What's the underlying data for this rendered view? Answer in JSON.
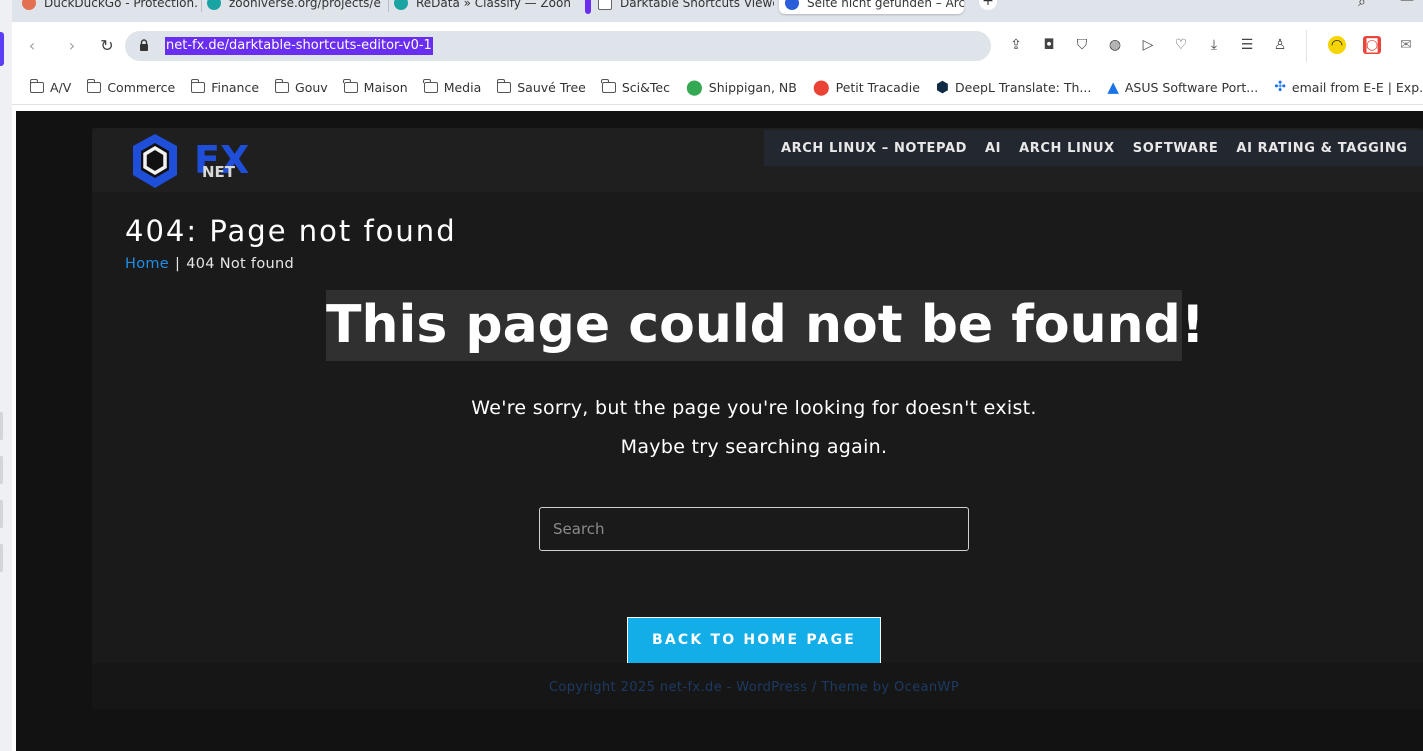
{
  "browser": {
    "tabs": [
      {
        "title": "DuckDuckGo - Protection.",
        "favicon": "duckduckgo-icon",
        "color": "#e37151"
      },
      {
        "title": "zooniverse.org/projects/e",
        "favicon": "zooniverse-icon",
        "color": "#1aa3a3"
      },
      {
        "title": "ReData » Classify — Zooni",
        "favicon": "zooniverse-icon",
        "color": "#1aa3a3"
      },
      {
        "title": "Darktable Shortcuts Viewe",
        "favicon": "image-icon",
        "color": "#666666"
      },
      {
        "title": "Seite nicht gefunden – Arc",
        "favicon": "netfx-icon",
        "color": "#2b5fd9"
      }
    ],
    "new_tab": "+",
    "url": "net-fx.de/darktable-shortcuts-editor-v0-1",
    "bookmarks": [
      {
        "label": "A/V",
        "icon": "folder-icon"
      },
      {
        "label": "Commerce",
        "icon": "folder-icon"
      },
      {
        "label": "Finance",
        "icon": "folder-icon"
      },
      {
        "label": "Gouv",
        "icon": "folder-icon"
      },
      {
        "label": "Maison",
        "icon": "folder-icon"
      },
      {
        "label": "Media",
        "icon": "folder-icon"
      },
      {
        "label": "Sauvé Tree",
        "icon": "folder-icon"
      },
      {
        "label": "Sci&Tec",
        "icon": "folder-icon"
      },
      {
        "label": "Shippigan, NB",
        "icon": "map-pin-icon"
      },
      {
        "label": "Petit Tracadie",
        "icon": "map-pin-icon"
      },
      {
        "label": "DeepL Translate: Th...",
        "icon": "deepl-icon"
      },
      {
        "label": "ASUS Software Port...",
        "icon": "asus-icon"
      },
      {
        "label": "email from E-E | Exp...",
        "icon": "experts-exchange-icon"
      }
    ]
  },
  "site": {
    "logo": {
      "letters": "FX",
      "sub": "NET"
    },
    "nav": [
      "ARCH LINUX – NOTEPAD",
      "AI",
      "ARCH LINUX",
      "SOFTWARE",
      "AI RATING & TAGGING"
    ],
    "page_title": "404: Page not found",
    "breadcrumb": {
      "home": "Home",
      "separator": "|",
      "current": "404 Not found"
    },
    "error_heading": "This page could not be found!",
    "error_line1": "We're sorry, but the page you're looking for doesn't exist.",
    "error_line2": "Maybe try searching again.",
    "search_placeholder": "Search",
    "back_button": "BACK TO HOME PAGE",
    "footer": {
      "prefix": "Copyright 2025 ",
      "brand": "net-fx.de",
      "sep": " - WordPress / ",
      "by": "Theme by OceanWP"
    }
  },
  "colors": {
    "accent": "#13aee8",
    "link": "#1e8fe8",
    "url_highlight": "#6a2ef0",
    "page_bg": "#121212"
  }
}
